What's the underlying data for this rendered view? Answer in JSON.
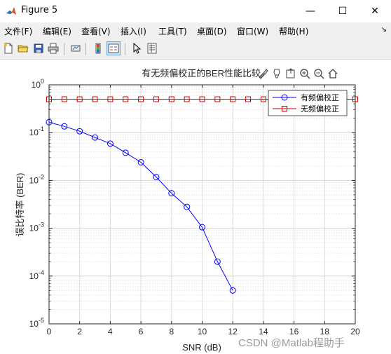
{
  "window": {
    "title": "Figure 5",
    "minimize": "—",
    "maximize": "☐",
    "close": "✕"
  },
  "menu": [
    "文件(F)",
    "编辑(E)",
    "查看(V)",
    "插入(I)",
    "工具(T)",
    "桌面(D)",
    "窗口(W)",
    "帮助(H)"
  ],
  "toolbar_icons": [
    "new-figure-icon",
    "open-folder-icon",
    "save-icon",
    "print-icon",
    "link-plot-icon",
    "colorbar-icon",
    "legend-icon",
    "pointer-icon",
    "property-inspector-icon"
  ],
  "axes_toolbar_icons": [
    "brush-icon",
    "data-tips-icon",
    "export-icon",
    "zoom-in-icon",
    "zoom-out-icon",
    "home-icon"
  ],
  "watermark": "CSDN @Matlab程助手",
  "chart_data": {
    "type": "line",
    "title": "有无频偏校正的BER性能比较",
    "xlabel": "SNR (dB)",
    "ylabel": "误比特率 (BER)",
    "xlim": [
      0,
      20
    ],
    "ylim": [
      1e-05,
      1
    ],
    "yscale": "log",
    "grid": true,
    "legend_position": "top-right",
    "x_ticks": [
      0,
      2,
      4,
      6,
      8,
      10,
      12,
      14,
      16,
      18,
      20
    ],
    "y_ticks": [
      {
        "value": 1,
        "label": "10^0"
      },
      {
        "value": 0.1,
        "label": "10^-1"
      },
      {
        "value": 0.01,
        "label": "10^-2"
      },
      {
        "value": 0.001,
        "label": "10^-3"
      },
      {
        "value": 0.0001,
        "label": "10^-4"
      },
      {
        "value": 1e-05,
        "label": "10^-5"
      }
    ],
    "series": [
      {
        "name": "有频偏校正",
        "color": "#0000ff",
        "marker": "circle",
        "x": [
          0,
          1,
          2,
          3,
          4,
          5,
          6,
          7,
          8,
          9,
          10,
          11,
          12
        ],
        "y": [
          0.165,
          0.135,
          0.107,
          0.079,
          0.059,
          0.038,
          0.024,
          0.0118,
          0.0054,
          0.0028,
          0.00105,
          0.0002,
          5e-05
        ]
      },
      {
        "name": "无频偏校正",
        "color": "#cc0000",
        "marker": "square",
        "x": [
          0,
          1,
          2,
          3,
          4,
          5,
          6,
          7,
          8,
          9,
          10,
          11,
          12,
          13,
          14,
          15,
          16,
          17,
          18,
          19,
          20
        ],
        "y": [
          0.5,
          0.5,
          0.5,
          0.5,
          0.5,
          0.5,
          0.5,
          0.5,
          0.5,
          0.5,
          0.5,
          0.5,
          0.5,
          0.5,
          0.5,
          0.5,
          0.5,
          0.5,
          0.5,
          0.5,
          0.5
        ]
      }
    ]
  }
}
